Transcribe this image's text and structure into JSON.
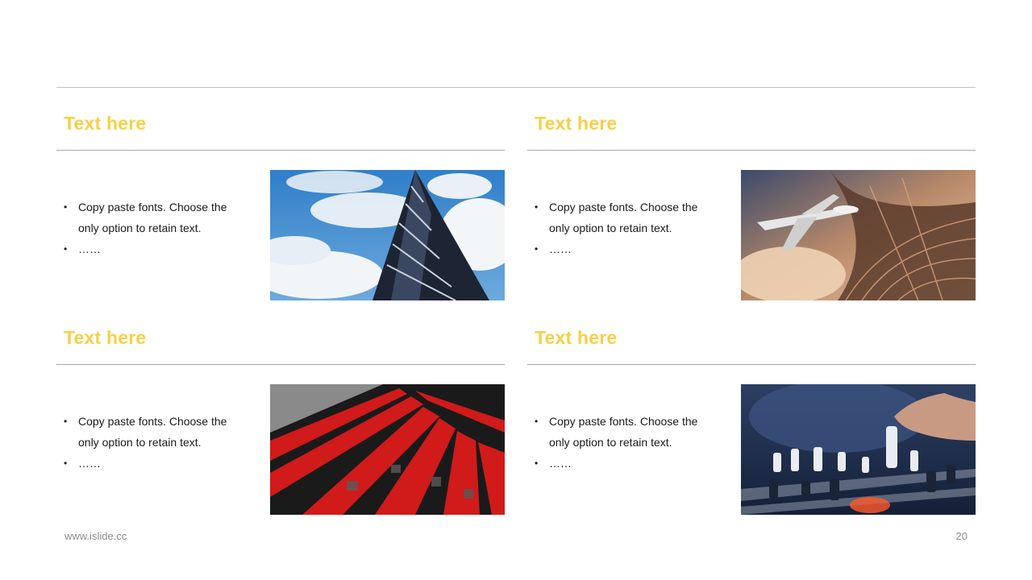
{
  "cards": [
    {
      "title": "Text here",
      "bullets": [
        "Copy paste fonts. Choose the only option to retain text.",
        "……"
      ],
      "image": "skyscraper-against-sky"
    },
    {
      "title": "Text here",
      "bullets": [
        "Copy paste fonts. Choose the only option to retain text.",
        "……"
      ],
      "image": "airplane-and-glass-dome"
    },
    {
      "title": "Text here",
      "bullets": [
        "Copy paste fonts. Choose the only option to retain text.",
        "……"
      ],
      "image": "red-building-facade"
    },
    {
      "title": "Text here",
      "bullets": [
        "Copy paste fonts. Choose the only option to retain text.",
        "……"
      ],
      "image": "hand-playing-chess"
    }
  ],
  "footer": {
    "website": "www.islide.cc",
    "page_number": "20"
  },
  "colors": {
    "accent": "#f7d046",
    "rule": "#a6a6a6",
    "text": "#1a1a1a",
    "footer": "#8c8c8c"
  }
}
